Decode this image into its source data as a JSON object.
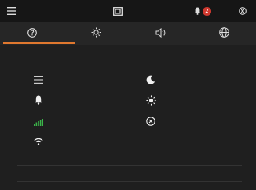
{
  "topbar": {
    "notification_count": "2",
    "icons": [
      "menu-icon",
      "screen-icon",
      "bell-icon",
      "close-icon"
    ]
  },
  "tabs": [
    {
      "icon": "help-icon",
      "active": true
    },
    {
      "icon": "brightness-icon",
      "active": false
    },
    {
      "icon": "volume-icon",
      "active": false
    },
    {
      "icon": "globe-icon",
      "active": false
    }
  ],
  "options": {
    "left": [
      "menu-icon",
      "bell-icon",
      "signal-icon",
      "wifi-icon"
    ],
    "right": [
      "moon-icon",
      "sun-icon",
      "close-circle-icon"
    ]
  },
  "colors": {
    "accent": "#e0782f",
    "badge": "#d0392f",
    "signal": "#3bb54a",
    "background": "#1f1f1f"
  }
}
